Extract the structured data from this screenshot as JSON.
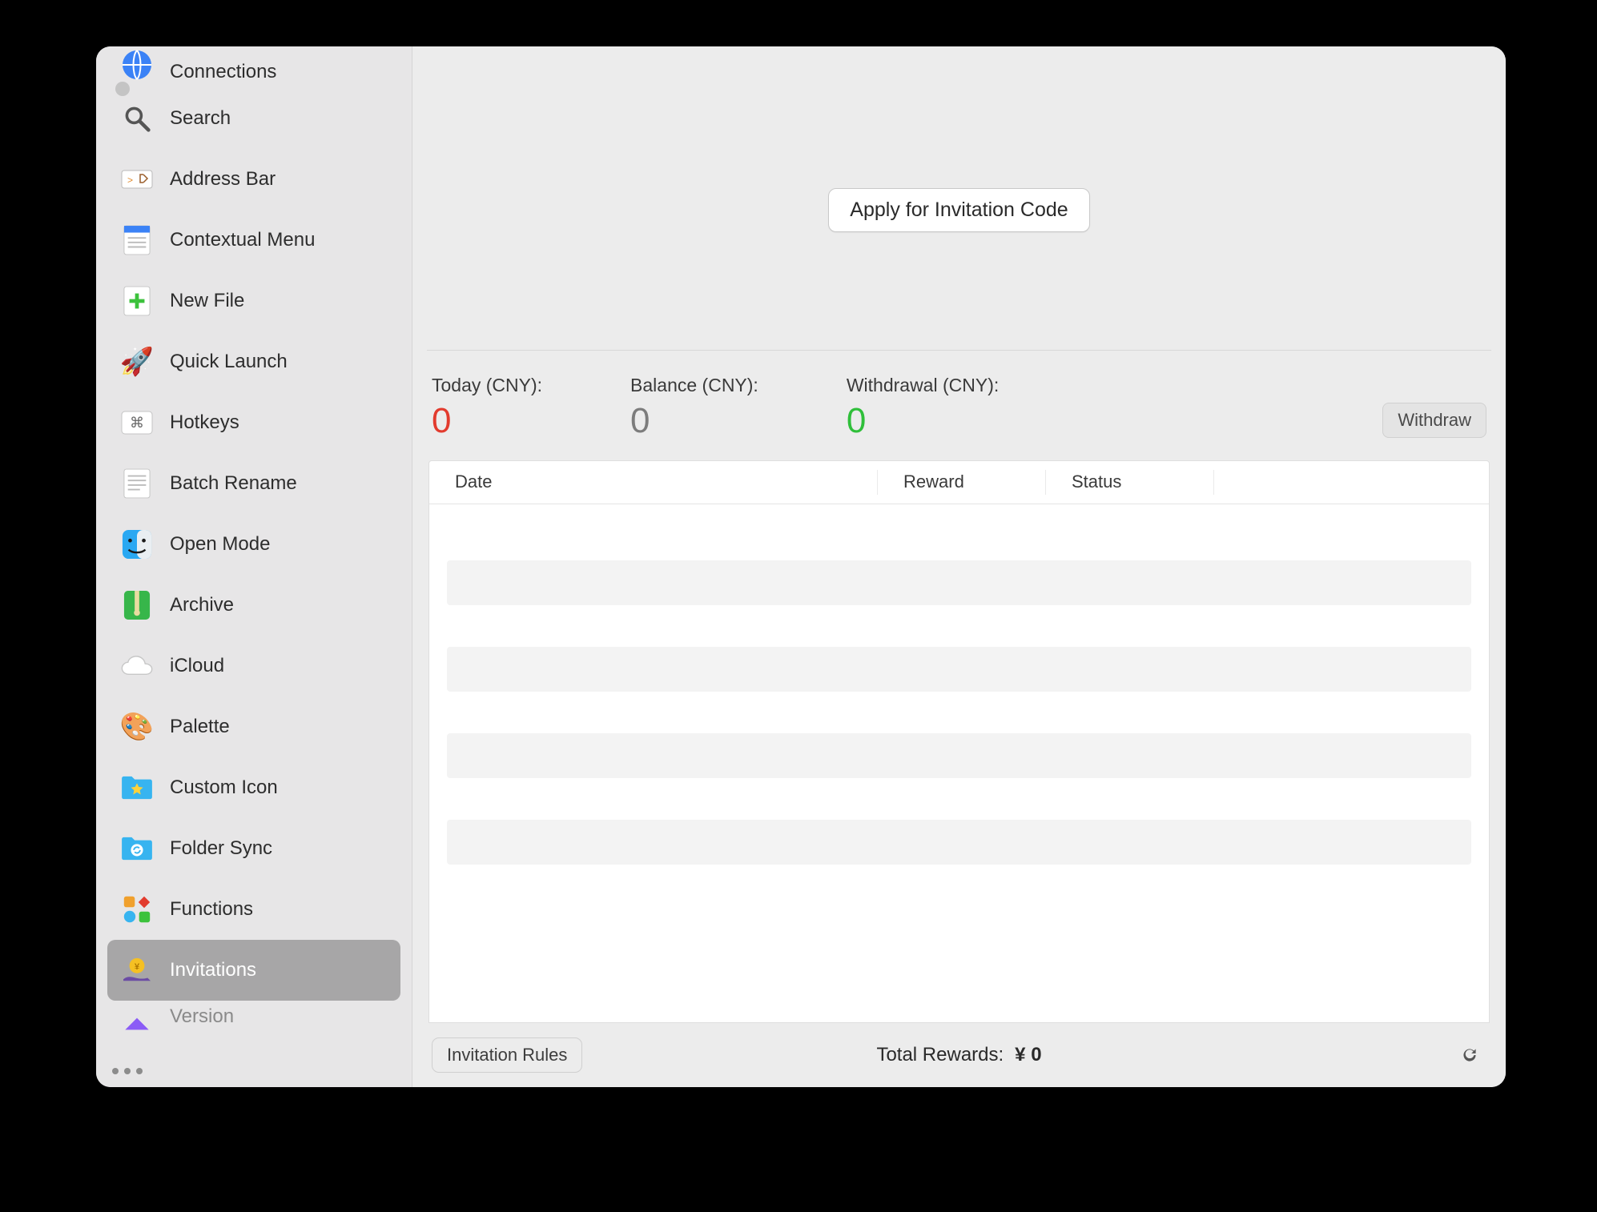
{
  "sidebar": {
    "items": [
      {
        "label": "Connections",
        "icon": "globe"
      },
      {
        "label": "Search",
        "icon": "search"
      },
      {
        "label": "Address Bar",
        "icon": "addressbar"
      },
      {
        "label": "Contextual Menu",
        "icon": "menu"
      },
      {
        "label": "New File",
        "icon": "plus"
      },
      {
        "label": "Quick Launch",
        "icon": "rocket"
      },
      {
        "label": "Hotkeys",
        "icon": "hotkeys"
      },
      {
        "label": "Batch Rename",
        "icon": "rename"
      },
      {
        "label": "Open Mode",
        "icon": "finder"
      },
      {
        "label": "Archive",
        "icon": "archive"
      },
      {
        "label": "iCloud",
        "icon": "icloud"
      },
      {
        "label": "Palette",
        "icon": "palette"
      },
      {
        "label": "Custom Icon",
        "icon": "star-folder"
      },
      {
        "label": "Folder Sync",
        "icon": "sync-folder"
      },
      {
        "label": "Functions",
        "icon": "functions"
      },
      {
        "label": "Invitations",
        "icon": "coin-hand"
      },
      {
        "label": "Version",
        "icon": "version"
      }
    ],
    "selected_index": 15
  },
  "main": {
    "apply_btn": "Apply for Invitation Code",
    "stats": {
      "today_label": "Today (CNY):",
      "today_value": "0",
      "balance_label": "Balance (CNY):",
      "balance_value": "0",
      "withdrawal_label": "Withdrawal (CNY):",
      "withdrawal_value": "0"
    },
    "withdraw_btn": "Withdraw",
    "table": {
      "columns": {
        "date": "Date",
        "reward": "Reward",
        "status": "Status"
      },
      "rows": []
    },
    "footer": {
      "rules_btn": "Invitation Rules",
      "total_label": "Total Rewards:",
      "total_amount": "¥ 0"
    }
  }
}
